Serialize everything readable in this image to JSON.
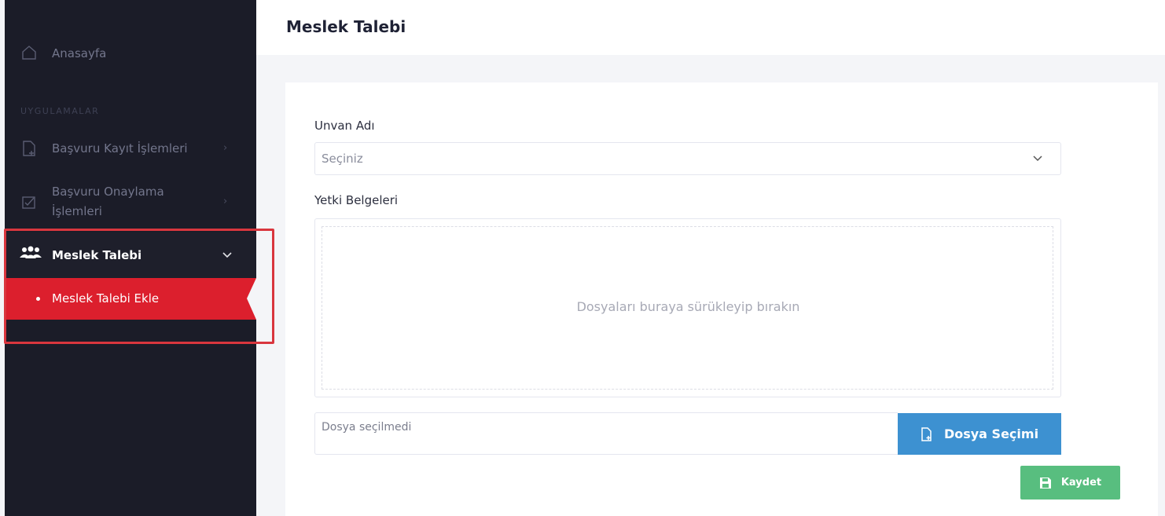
{
  "sidebar": {
    "home_label": "Anasayfa",
    "section_title": "UYGULAMALAR",
    "items": [
      {
        "label": "Başvuru Kayıt İşlemleri",
        "icon": "file-add-icon"
      },
      {
        "label_line1": "Başvuru Onaylama",
        "label_line2": "İşlemleri",
        "icon": "check-doc-icon"
      },
      {
        "label": "Meslek Talebi",
        "icon": "users-icon"
      }
    ],
    "submenu": {
      "label": "Meslek Talebi Ekle"
    }
  },
  "header": {
    "title": "Meslek Talebi"
  },
  "form": {
    "unvan_label": "Unvan Adı",
    "unvan_placeholder": "Seçiniz",
    "yetki_label": "Yetki Belgeleri",
    "dropzone_text": "Dosyaları buraya sürükleyip bırakın",
    "file_status": "Dosya seçilmedi",
    "file_button": "Dosya Seçimi",
    "save_button": "Kaydet"
  },
  "colors": {
    "sidebar_bg": "#1b1c28",
    "active_submenu": "#dc1f2d",
    "file_button": "#3d91d1",
    "save_button": "#58be7f"
  }
}
